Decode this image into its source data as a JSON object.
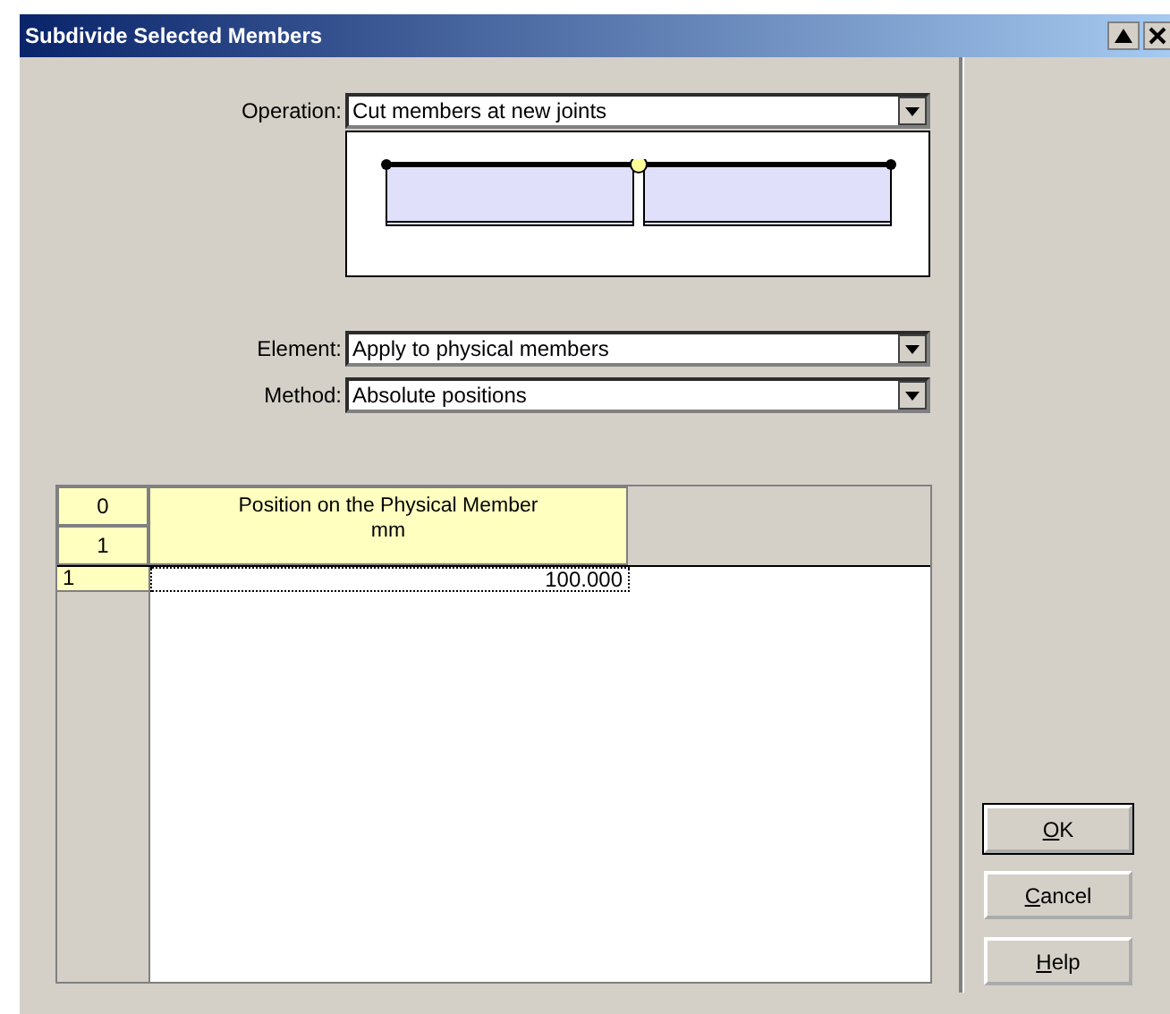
{
  "window": {
    "title": "Subdivide Selected Members"
  },
  "fields": [
    {
      "label": "Operation:",
      "value": "Cut members at new joints"
    },
    {
      "label": "Element:",
      "value": "Apply to physical members"
    },
    {
      "label": "Method:",
      "value": "Absolute positions"
    }
  ],
  "grid": {
    "corner_rows": [
      "0",
      "1"
    ],
    "column_header": {
      "title": "Position on the Physical Member",
      "unit": "mm"
    },
    "rows": [
      {
        "header": "1",
        "value": "100.000",
        "selected": true
      }
    ]
  },
  "buttons": [
    {
      "mnemonic": "O",
      "rest": "K",
      "default": true
    },
    {
      "mnemonic": "C",
      "rest": "ancel",
      "default": false
    },
    {
      "mnemonic": "H",
      "rest": "elp",
      "default": false
    }
  ]
}
